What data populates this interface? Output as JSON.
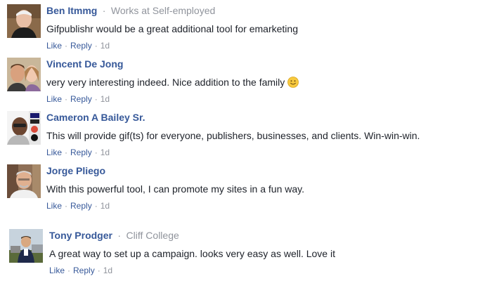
{
  "actions": {
    "like_label": "Like",
    "reply_label": "Reply",
    "separator": "·"
  },
  "comments": [
    {
      "author": "Ben Itmmg",
      "work": "Works at Self-employed",
      "text": "Gifpublishr would be a great additional tool for emarketing",
      "time": "1d"
    },
    {
      "author": "Vincent De Jong",
      "work": "",
      "text": "very very interesting indeed. Nice addition to the family",
      "emoji": "slightly-smiling-face-icon",
      "time": "1d"
    },
    {
      "author": "Cameron A Bailey Sr.",
      "work": "",
      "text": "This will provide gif(ts) for everyone, publishers, businesses, and clients. Win-win-win.",
      "time": "1d"
    },
    {
      "author": "Jorge Pliego",
      "work": "",
      "text": "With this powerful tool, I can promote my sites in a fun way.",
      "time": "1d"
    },
    {
      "author": "Tony Prodger",
      "work": "Cliff College",
      "text": "A great way to set up a campaign. looks very easy as well. Love it",
      "time": "1d"
    }
  ],
  "colors": {
    "name": "#365899",
    "meta": "#90949c",
    "text": "#1d2129"
  }
}
